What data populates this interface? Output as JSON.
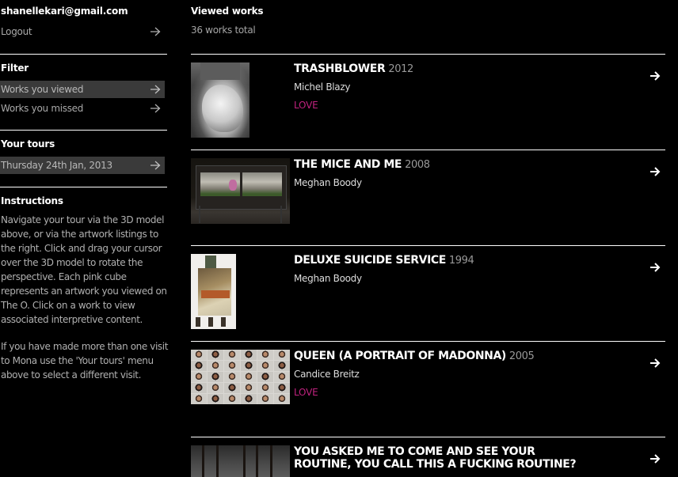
{
  "sidebar": {
    "account": {
      "email": "shanellekari@gmail.com",
      "logout_label": "Logout"
    },
    "filter": {
      "heading": "Filter",
      "items": [
        {
          "label": "Works you viewed",
          "active": true
        },
        {
          "label": "Works you missed",
          "active": false
        }
      ]
    },
    "tours": {
      "heading": "Your tours",
      "items": [
        {
          "label": "Thursday 24th Jan, 2013",
          "active": true
        }
      ]
    },
    "instructions": {
      "heading": "Instructions",
      "paragraphs": [
        "Navigate your tour via the 3D model above, or via the artwork listings to the right. Click and drag your cursor over the 3D model to rotate the perspective. Each pink cube represents an artwork you viewed on The O. Click on a work to view associated interpretive content.",
        "If you have made more than one visit to Mona use the 'Your tours' menu above to select a different visit."
      ]
    }
  },
  "main": {
    "title": "Viewed works",
    "count_label": "36 works total",
    "works": [
      {
        "title": "TRASHBLOWER",
        "year": "2012",
        "artist": "Michel Blazy",
        "love": "LOVE",
        "thumbnail": "trashblower-image"
      },
      {
        "title": "THE MICE AND ME",
        "year": "2008",
        "artist": "Meghan Boody",
        "love": "",
        "thumbnail": "mice-and-me-image"
      },
      {
        "title": "DELUXE SUICIDE SERVICE",
        "year": "1994",
        "artist": "Meghan Boody",
        "love": "",
        "thumbnail": "deluxe-suicide-service-image"
      },
      {
        "title": "QUEEN (A PORTRAIT OF MADONNA)",
        "year": "2005",
        "artist": "Candice Breitz",
        "love": "LOVE",
        "thumbnail": "queen-portrait-grid-image"
      },
      {
        "title_lines": [
          "YOU ASKED ME TO COME AND SEE YOUR",
          "ROUTINE, YOU CALL THIS A FUCKING ROUTINE?"
        ],
        "year": "",
        "artist": "",
        "love": "",
        "thumbnail": "routine-image"
      }
    ]
  },
  "icons": {
    "row_arrow": "arrow-right-icon",
    "work_arrow": "arrow-right-bold-icon"
  },
  "colors": {
    "background": "#000000",
    "love_accent": "#c0227f",
    "active_row_bg": "#3a3a3a",
    "muted_text": "#a9a9a9"
  }
}
